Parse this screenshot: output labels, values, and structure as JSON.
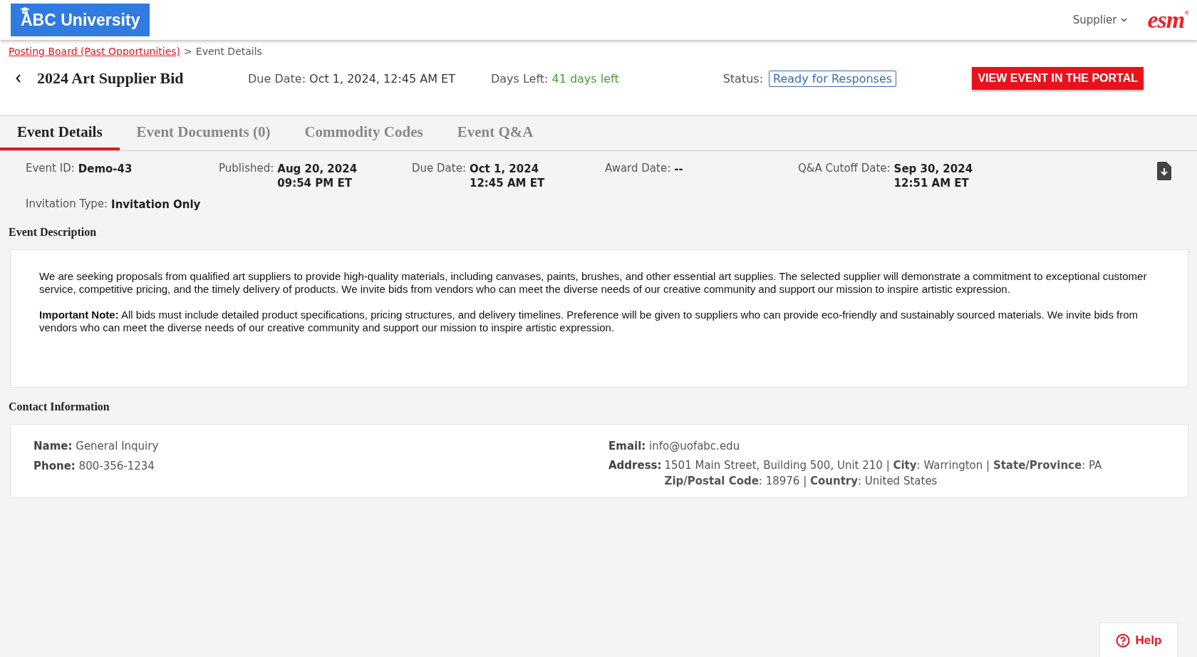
{
  "header": {
    "logo": "ABC University",
    "user_menu": "Supplier",
    "brand": "esm",
    "brand_mark": "®"
  },
  "breadcrumb": {
    "link": "Posting Board (Past Opportunities)",
    "separator": ">",
    "current": "Event Details"
  },
  "event": {
    "title": "2024 Art Supplier Bid",
    "due_label": "Due Date:",
    "due_value": "Oct 1, 2024, 12:45 AM ET",
    "days_label": "Days Left:",
    "days_value": "41 days left",
    "status_label": "Status:",
    "status_value": "Ready for Responses",
    "portal_button": "VIEW EVENT IN THE PORTAL"
  },
  "tabs": [
    {
      "label": "Event Details",
      "selected": true
    },
    {
      "label": "Event Documents (0)",
      "selected": false
    },
    {
      "label": "Commodity Codes",
      "selected": false
    },
    {
      "label": "Event Q&A",
      "selected": false
    }
  ],
  "details": [
    {
      "label": "Event ID:",
      "lines": [
        "Demo-43"
      ]
    },
    {
      "label": "Published:",
      "lines": [
        "Aug 20, 2024",
        "09:54 PM ET"
      ]
    },
    {
      "label": "Due Date:",
      "lines": [
        "Oct 1, 2024",
        "12:45 AM ET"
      ]
    },
    {
      "label": "Award Date:",
      "lines": [
        "--"
      ]
    },
    {
      "label": "Q&A Cutoff Date:",
      "lines": [
        "Sep 30, 2024",
        "12:51 AM ET"
      ]
    },
    {
      "label": "Invitation Type:",
      "lines": [
        "Invitation Only"
      ]
    }
  ],
  "description": {
    "heading": "Event Description",
    "paragraphs": [
      "We are seeking proposals from qualified art suppliers to provide high-quality materials, including canvases, paints, brushes, and other essential art supplies. The selected supplier will demonstrate a commitment to exceptional customer service, competitive pricing, and the timely delivery of products. We invite bids from vendors who can meet the diverse needs of our creative community and support our mission to inspire artistic expression.",
      "**Important Note:** All bids must include detailed product specifications, pricing structures, and delivery timelines. Preference will be given to suppliers who can provide eco-friendly and sustainably sourced materials. We invite bids from vendors who can meet the diverse needs of our creative community and support our mission to inspire artistic expression."
    ]
  },
  "contact": {
    "heading": "Contact Information",
    "name_label": "Name:",
    "name": "General Inquiry",
    "phone_label": "Phone:",
    "phone": "800-356-1234",
    "email_label": "Email:",
    "email": "info@uofabc.edu",
    "address_label": "Address:",
    "address_lines": [
      "1501 Main Street, Building 500, Unit 210 | **City**: Warrington | **State/Province**: PA",
      "**Zip/Postal Code**: 18976 | **Country**: United States"
    ]
  },
  "help": "Help"
}
